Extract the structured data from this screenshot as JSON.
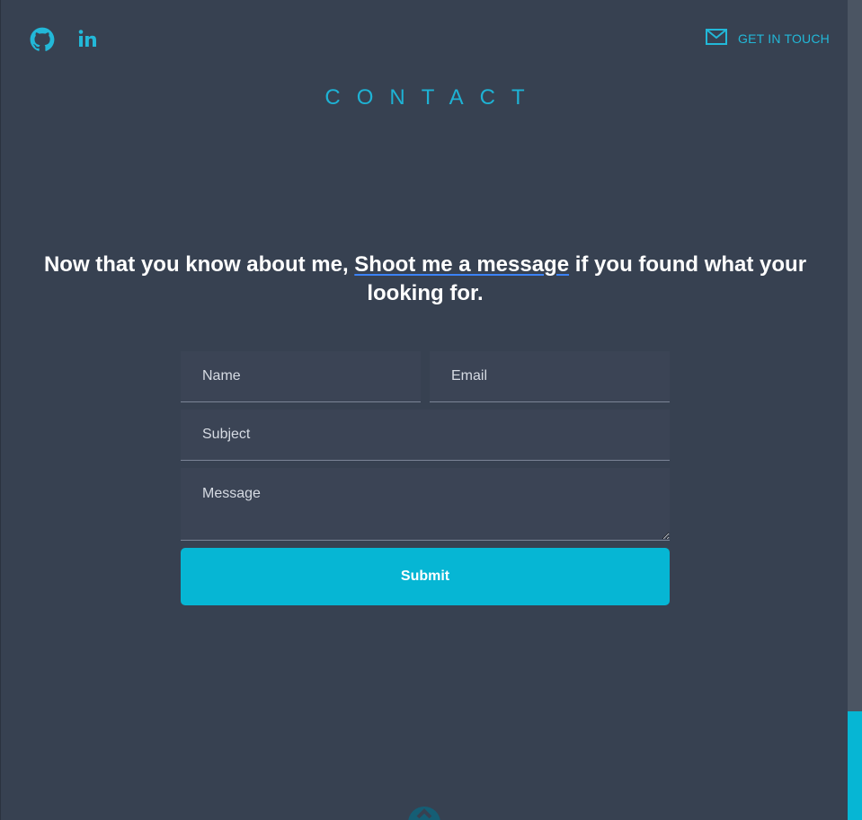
{
  "header": {
    "github_icon": "github-icon",
    "linkedin_icon": "linkedin-icon",
    "get_in_touch_label": "GET IN TOUCH",
    "mail_icon": "mail-icon"
  },
  "section": {
    "title": "CONTACT"
  },
  "headline": {
    "before": "Now that you know about me, ",
    "link": "Shoot me a message",
    "after": " if you found what your looking for."
  },
  "form": {
    "name_placeholder": "Name",
    "email_placeholder": "Email",
    "subject_placeholder": "Subject",
    "message_placeholder": "Message",
    "submit_label": "Submit"
  },
  "colors": {
    "background": "#374151",
    "accent": "#06b6d4",
    "field_bg": "#3b4455",
    "text": "#ffffff"
  }
}
